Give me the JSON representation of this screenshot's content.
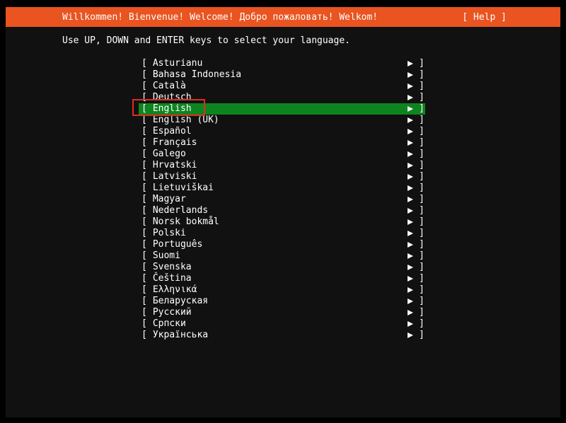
{
  "header": {
    "title": "Willkommen! Bienvenue! Welcome! Добро пожаловать! Welkom!",
    "help_label": "[ Help ]"
  },
  "instruction": "Use UP, DOWN and ENTER keys to select your language.",
  "language_list": {
    "open_bracket": "[",
    "close_bracket": "]",
    "selected_index": 4,
    "selected_language": "English",
    "items": [
      "Asturianu",
      "Bahasa Indonesia",
      "Català",
      "Deutsch",
      "English",
      "English (UK)",
      "Español",
      "Français",
      "Galego",
      "Hrvatski",
      "Latviski",
      "Lietuviškai",
      "Magyar",
      "Nederlands",
      "Norsk bokmål",
      "Polski",
      "Português",
      "Suomi",
      "Svenska",
      "Čeština",
      "Ελληνικά",
      "Беларуская",
      "Русский",
      "Српски",
      "Українська"
    ]
  },
  "annotation": {
    "type": "red-highlight-box",
    "target": "English"
  },
  "colors": {
    "accent_orange": "#E95420",
    "selected_green": "#0E8420",
    "annotation_red": "#E02B20",
    "screen_background": "#111111",
    "outer_border": "#000000",
    "text": "#FFFFFF"
  },
  "icons": {
    "row_arrow": "right-pointer-icon"
  }
}
